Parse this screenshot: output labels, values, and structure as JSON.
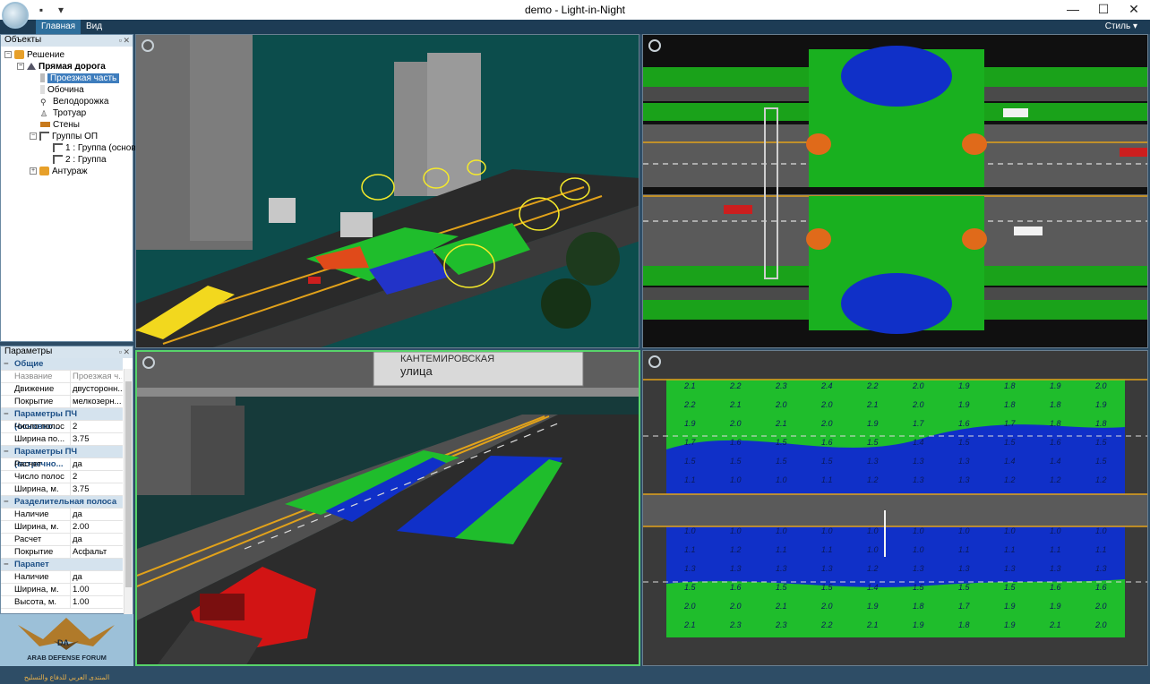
{
  "window": {
    "title": "demo - Light-in-Night",
    "minimize_glyph": "—",
    "maximize_glyph": "☐",
    "close_glyph": "✕"
  },
  "ribbon": {
    "tabs": [
      {
        "label": "Главная",
        "active": true
      },
      {
        "label": "Вид",
        "active": false
      }
    ],
    "style_menu": "Стиль"
  },
  "objects_panel": {
    "title": "Объекты",
    "tree": {
      "root": "Решение",
      "road": "Прямая дорога",
      "roadway": "Проезжая часть",
      "shoulder": "Обочина",
      "bike_lane": "Велодорожка",
      "sidewalk": "Тротуар",
      "walls": "Стены",
      "groups": "Группы ОП",
      "group1": "1 : Группа (основ",
      "group2": "2 : Группа",
      "surroundings": "Антураж"
    }
  },
  "params_panel": {
    "title": "Параметры",
    "general": {
      "header": "Общие",
      "name_label": "Название",
      "name_value": "Проезжая ч...",
      "movement_label": "Движение",
      "movement_value": "двусторонн...",
      "surface_label": "Покрытие",
      "surface_value": "мелкозерн..."
    },
    "main_roadway": {
      "header": "Параметры ПЧ (основно...",
      "lanes_label": "Число полос",
      "lanes_value": "2",
      "width_label": "Ширина по...",
      "width_value": "3.75"
    },
    "oncoming_roadway": {
      "header": "Параметры ПЧ (встречно...",
      "calc_label": "Расчет",
      "calc_value": "да",
      "lanes_label": "Число полос",
      "lanes_value": "2",
      "width_label": "Ширина, м.",
      "width_value": "3.75"
    },
    "divider": {
      "header": "Разделительная полоса",
      "presence_label": "Наличие",
      "presence_value": "да",
      "width_label": "Ширина, м.",
      "width_value": "2.00",
      "calc_label": "Расчет",
      "calc_value": "да",
      "surface_label": "Покрытие",
      "surface_value": "Асфальт"
    },
    "parapet": {
      "header": "Парапет",
      "presence_label": "Наличие",
      "presence_value": "да",
      "width_label": "Ширина, м.",
      "width_value": "1.00",
      "height_label": "Высота, м.",
      "height_value": "1.00"
    }
  },
  "viewport3": {
    "sign_line1": "КАНТЕМИРОВСКАЯ",
    "sign_line2": "улица"
  },
  "viewport4": {
    "upper_rows": [
      [
        "2.1",
        "2.2",
        "2.3",
        "2.4",
        "2.2",
        "2.0",
        "1.9",
        "1.8",
        "1.9",
        "2.0"
      ],
      [
        "2.2",
        "2.1",
        "2.0",
        "2.0",
        "2.1",
        "2.0",
        "1.9",
        "1.8",
        "1.8",
        "1.9"
      ],
      [
        "1.9",
        "2.0",
        "2.1",
        "2.0",
        "1.9",
        "1.7",
        "1.6",
        "1.7",
        "1.8",
        "1.8"
      ],
      [
        "1.7",
        "1.6",
        "1.5",
        "1.6",
        "1.5",
        "1.4",
        "1.5",
        "1.5",
        "1.6",
        "1.5"
      ],
      [
        "1.5",
        "1.5",
        "1.5",
        "1.5",
        "1.3",
        "1.3",
        "1.3",
        "1.4",
        "1.4",
        "1.5"
      ],
      [
        "1.1",
        "1.0",
        "1.0",
        "1.1",
        "1.2",
        "1.3",
        "1.3",
        "1.2",
        "1.2",
        "1.2"
      ]
    ],
    "lower_rows": [
      [
        "1.0",
        "1.0",
        "1.0",
        "1.0",
        "1.0",
        "1.0",
        "1.0",
        "1.0",
        "1.0",
        "1.0"
      ],
      [
        "1.1",
        "1.2",
        "1.1",
        "1.1",
        "1.0",
        "1.0",
        "1.1",
        "1.1",
        "1.1",
        "1.1"
      ],
      [
        "1.3",
        "1.3",
        "1.3",
        "1.3",
        "1.2",
        "1.3",
        "1.3",
        "1.3",
        "1.3",
        "1.3"
      ],
      [
        "1.5",
        "1.6",
        "1.5",
        "1.5",
        "1.4",
        "1.5",
        "1.5",
        "1.5",
        "1.6",
        "1.6"
      ],
      [
        "2.0",
        "2.0",
        "2.1",
        "2.0",
        "1.9",
        "1.8",
        "1.7",
        "1.9",
        "1.9",
        "2.0"
      ],
      [
        "2.1",
        "2.3",
        "2.3",
        "2.2",
        "2.1",
        "1.9",
        "1.8",
        "1.9",
        "2.1",
        "2.0"
      ]
    ]
  },
  "watermark": {
    "badge": "DA",
    "line1": "ARAB DEFENSE FORUM",
    "line2": "المنتدى العربي للدفاع والتسليح"
  }
}
